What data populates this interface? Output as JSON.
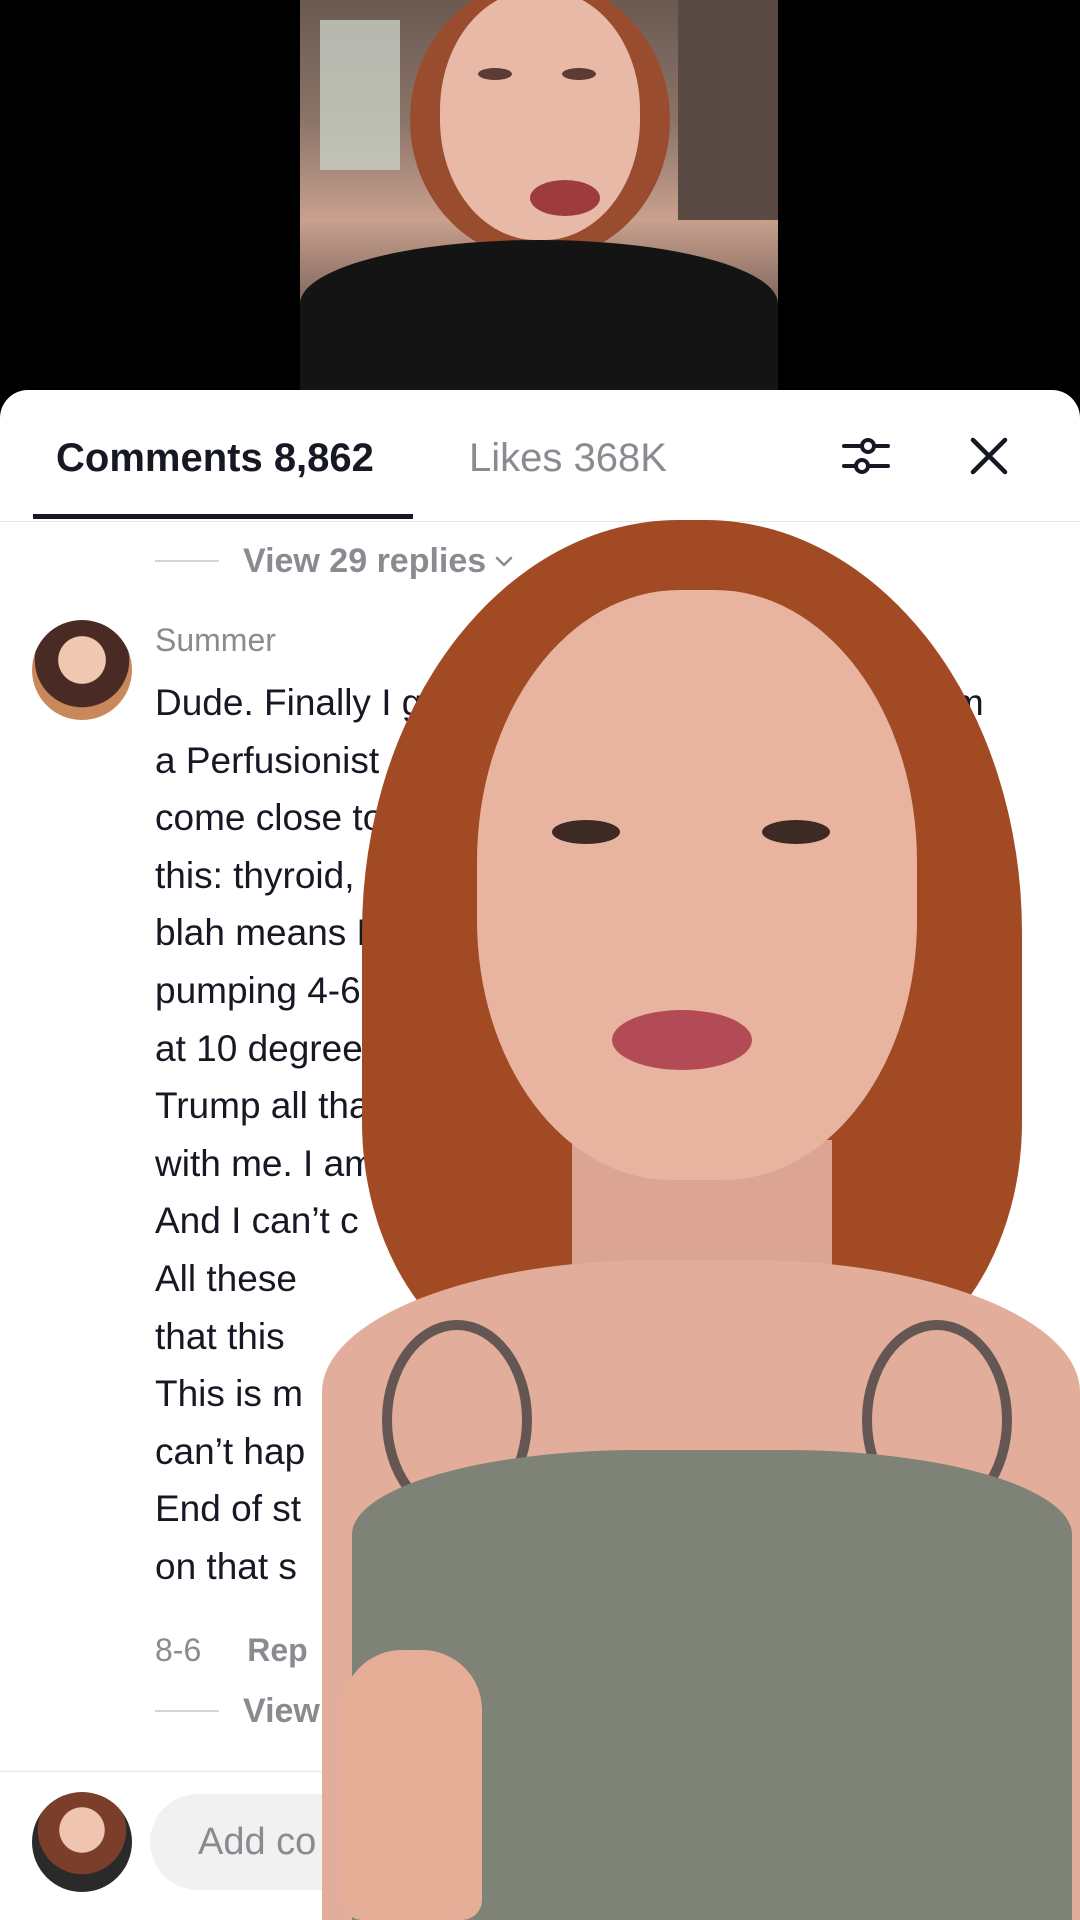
{
  "header": {
    "comments_tab": "Comments 8,862",
    "likes_tab": "Likes 368K"
  },
  "icons": {
    "filter": "filter-sliders-icon",
    "close": "close-icon",
    "chevron": "chevron-down-icon"
  },
  "thread": {
    "view_replies_top": "View 29 replies",
    "author": "Summer",
    "comment_lines": [
      "Dude. Finally I got                                        fyp. I’m",
      "a Perfusionist and                                       e even",
      "come close to c                                           an. All",
      "this: thyroid, sp                                            blah",
      "blah means NO",
      "pumping 4-6 L                                              ood",
      "at 10 degrees C",
      "Trump all that. F                                            e",
      "with me. I am t",
      "And I can’t c",
      "All these",
      "that this",
      "This is m",
      "can’t hap",
      "End of st",
      "on that s"
    ],
    "date": "8-6",
    "reply": "Rep",
    "view_replies_bottom": "View"
  },
  "composer": {
    "placeholder": "Add co"
  },
  "colors": {
    "primary_text": "#161823",
    "secondary_text": "#8a8b91",
    "sheet_bg": "#ffffff"
  }
}
